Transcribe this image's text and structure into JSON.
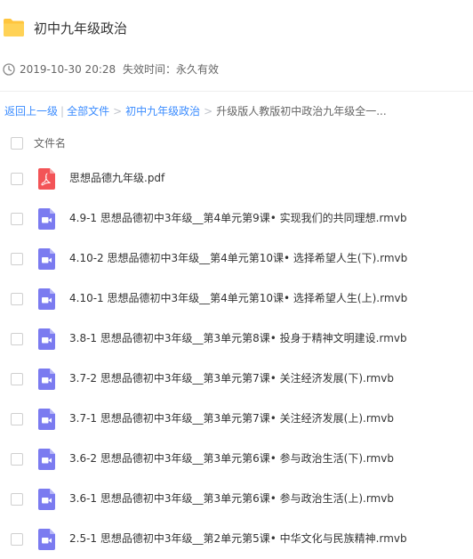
{
  "header": {
    "title": "初中九年级政治",
    "icon": "folder-icon",
    "icon_color": "#ffc53d"
  },
  "meta": {
    "created": "2019-10-30 20:28",
    "expiry": "失效时间：永久有效"
  },
  "breadcrumb": {
    "back": "返回上一级",
    "all_files": "全部文件",
    "folder": "初中九年级政治",
    "current": "升级版人教版初中政治九年级全一..."
  },
  "list": {
    "column_name": "文件名",
    "files": [
      {
        "name": "思想品德九年级.pdf",
        "type": "pdf",
        "icon": "pdf-file-icon"
      },
      {
        "name": "4.9-1 思想品德初中3年级__第4单元第9课• 实现我们的共同理想.rmvb",
        "type": "video",
        "icon": "video-file-icon"
      },
      {
        "name": "4.10-2 思想品德初中3年级__第4单元第10课• 选择希望人生(下).rmvb",
        "type": "video",
        "icon": "video-file-icon"
      },
      {
        "name": "4.10-1 思想品德初中3年级__第4单元第10课• 选择希望人生(上).rmvb",
        "type": "video",
        "icon": "video-file-icon"
      },
      {
        "name": "3.8-1 思想品德初中3年级__第3单元第8课• 投身于精神文明建设.rmvb",
        "type": "video",
        "icon": "video-file-icon"
      },
      {
        "name": "3.7-2 思想品德初中3年级__第3单元第7课• 关注经济发展(下).rmvb",
        "type": "video",
        "icon": "video-file-icon"
      },
      {
        "name": "3.7-1 思想品德初中3年级__第3单元第7课• 关注经济发展(上).rmvb",
        "type": "video",
        "icon": "video-file-icon"
      },
      {
        "name": "3.6-2 思想品德初中3年级__第3单元第6课• 参与政治生活(下).rmvb",
        "type": "video",
        "icon": "video-file-icon"
      },
      {
        "name": "3.6-1 思想品德初中3年级__第3单元第6课• 参与政治生活(上).rmvb",
        "type": "video",
        "icon": "video-file-icon"
      },
      {
        "name": "2.5-1 思想品德初中3年级__第2单元第5课• 中华文化与民族精神.rmvb",
        "type": "video",
        "icon": "video-file-icon"
      }
    ]
  },
  "colors": {
    "link": "#3b8cff",
    "pdf_red": "#f35457",
    "video_purple": "#7b7bf0",
    "folder_yellow": "#ffc53d"
  }
}
